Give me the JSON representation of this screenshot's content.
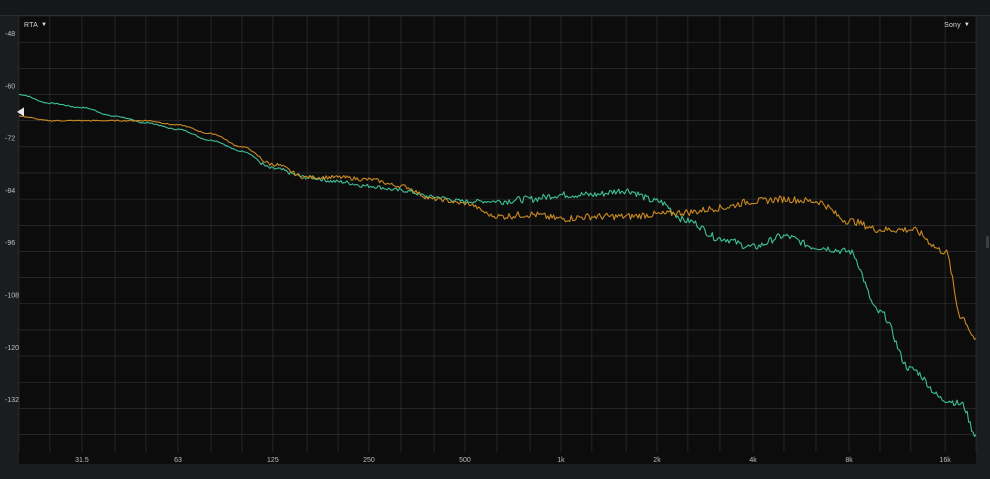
{
  "toolbar": {
    "rta_label": "RTA",
    "device_label": "Sony",
    "caret_icon": "triangle-down-icon"
  },
  "colors": {
    "background": "#0c0c0c",
    "frame": "#1b1c1e",
    "grid": "#34363a",
    "tick_label": "#bfbfbf",
    "marker": "#e8e8e8"
  },
  "chart_data": {
    "type": "line",
    "title": "",
    "xlabel": "",
    "ylabel": "",
    "x_scale": "log",
    "xlim": [
      20,
      20000
    ],
    "ylim": [
      -144,
      -44
    ],
    "x_ticks": [
      {
        "value": 31.5,
        "label": "31.5"
      },
      {
        "value": 63,
        "label": "63"
      },
      {
        "value": 125,
        "label": "125"
      },
      {
        "value": 250,
        "label": "250"
      },
      {
        "value": 500,
        "label": "500"
      },
      {
        "value": 1000,
        "label": "1k"
      },
      {
        "value": 2000,
        "label": "2k"
      },
      {
        "value": 4000,
        "label": "4k"
      },
      {
        "value": 8000,
        "label": "8k"
      },
      {
        "value": 16000,
        "label": "16k"
      }
    ],
    "y_ticks": [
      {
        "value": -48,
        "label": "-48"
      },
      {
        "value": -60,
        "label": "-60"
      },
      {
        "value": -72,
        "label": "-72"
      },
      {
        "value": -84,
        "label": "-84"
      },
      {
        "value": -96,
        "label": "-96"
      },
      {
        "value": -108,
        "label": "-108"
      },
      {
        "value": -120,
        "label": "-120"
      },
      {
        "value": -132,
        "label": "-132"
      }
    ],
    "grid": true,
    "reference_marker_db": -66,
    "series": [
      {
        "color": "#3dbf98",
        "x": [
          20,
          25,
          31.5,
          40,
          50,
          63,
          80,
          100,
          125,
          160,
          200,
          250,
          315,
          400,
          500,
          630,
          800,
          1000,
          1250,
          1600,
          2000,
          2500,
          3150,
          4000,
          5000,
          6300,
          8000,
          10000,
          12500,
          16000,
          18000,
          20000
        ],
        "y": [
          -62,
          -64,
          -65,
          -67,
          -68.5,
          -70,
          -72.5,
          -75,
          -79,
          -81,
          -82,
          -83,
          -84,
          -85.5,
          -86.5,
          -86.5,
          -86,
          -85,
          -85,
          -84,
          -86.5,
          -91,
          -95,
          -97,
          -94.5,
          -97,
          -98,
          -112,
          -125,
          -132,
          -133,
          -140
        ]
      },
      {
        "color": "#c98922",
        "x": [
          20,
          25,
          31.5,
          40,
          50,
          63,
          80,
          100,
          125,
          160,
          200,
          250,
          315,
          400,
          500,
          630,
          800,
          1000,
          1250,
          1600,
          2000,
          2500,
          3150,
          4000,
          5000,
          6300,
          8000,
          10000,
          12500,
          16000,
          18000,
          20000
        ],
        "y": [
          -67,
          -68,
          -68,
          -68,
          -68,
          -69,
          -71,
          -74,
          -78,
          -81,
          -81,
          -81.5,
          -83,
          -86,
          -87,
          -90,
          -89.5,
          -90.5,
          -90,
          -90,
          -89.5,
          -89,
          -88,
          -86.5,
          -86,
          -86.5,
          -91,
          -93,
          -93,
          -98,
          -113,
          -118
        ]
      }
    ]
  }
}
